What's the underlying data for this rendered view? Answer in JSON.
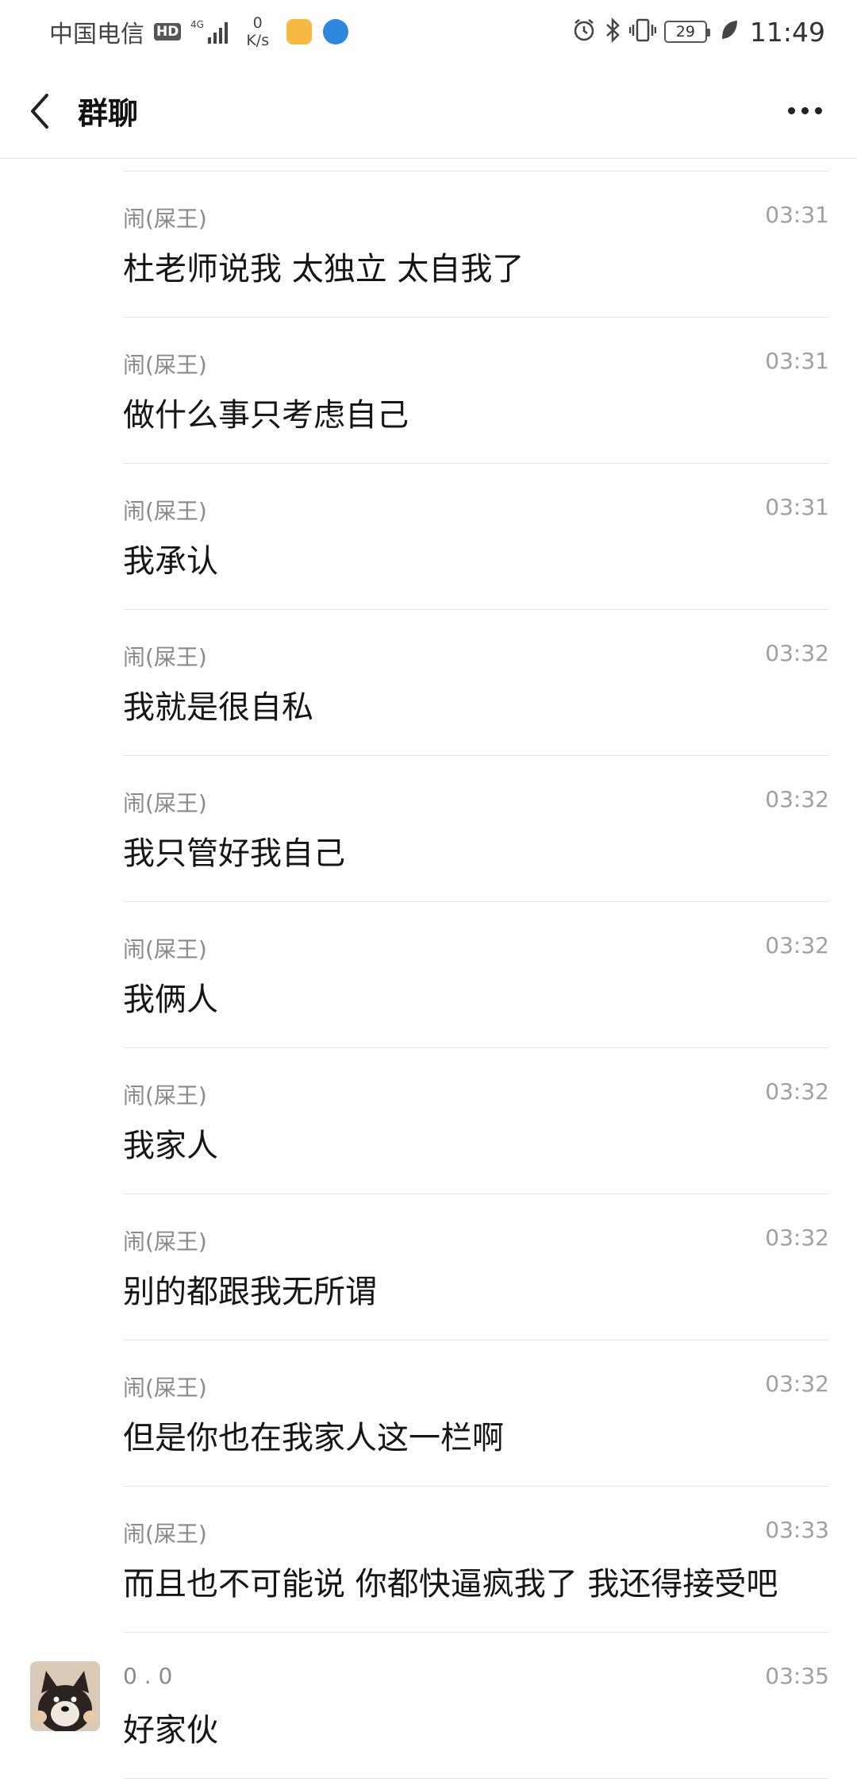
{
  "status_bar": {
    "carrier": "中国电信",
    "hd": "HD",
    "network": "4G",
    "speed_value": "0",
    "speed_unit": "K/s",
    "battery": "29",
    "time": "11:49",
    "icons": [
      "signal-icon",
      "alarm-icon",
      "bluetooth-icon",
      "vibrate-icon",
      "battery-icon",
      "leaf-icon"
    ]
  },
  "nav": {
    "title": "群聊"
  },
  "messages": [
    {
      "sender": "闹(屎王)",
      "time": "03:31",
      "text": "杜老师说我 太独立 太自我了"
    },
    {
      "sender": "闹(屎王)",
      "time": "03:31",
      "text": "做什么事只考虑自己"
    },
    {
      "sender": "闹(屎王)",
      "time": "03:31",
      "text": "我承认"
    },
    {
      "sender": "闹(屎王)",
      "time": "03:32",
      "text": "我就是很自私"
    },
    {
      "sender": "闹(屎王)",
      "time": "03:32",
      "text": "我只管好我自己"
    },
    {
      "sender": "闹(屎王)",
      "time": "03:32",
      "text": "我俩人"
    },
    {
      "sender": "闹(屎王)",
      "time": "03:32",
      "text": "我家人"
    },
    {
      "sender": "闹(屎王)",
      "time": "03:32",
      "text": "别的都跟我无所谓"
    },
    {
      "sender": "闹(屎王)",
      "time": "03:32",
      "text": "但是你也在我家人这一栏啊"
    },
    {
      "sender": "闹(屎王)",
      "time": "03:33",
      "text": "而且也不可能说 你都快逼疯我了 我还得接受吧"
    },
    {
      "sender": "0 . 0",
      "time": "03:35",
      "text": "好家伙",
      "has_avatar": true
    }
  ]
}
